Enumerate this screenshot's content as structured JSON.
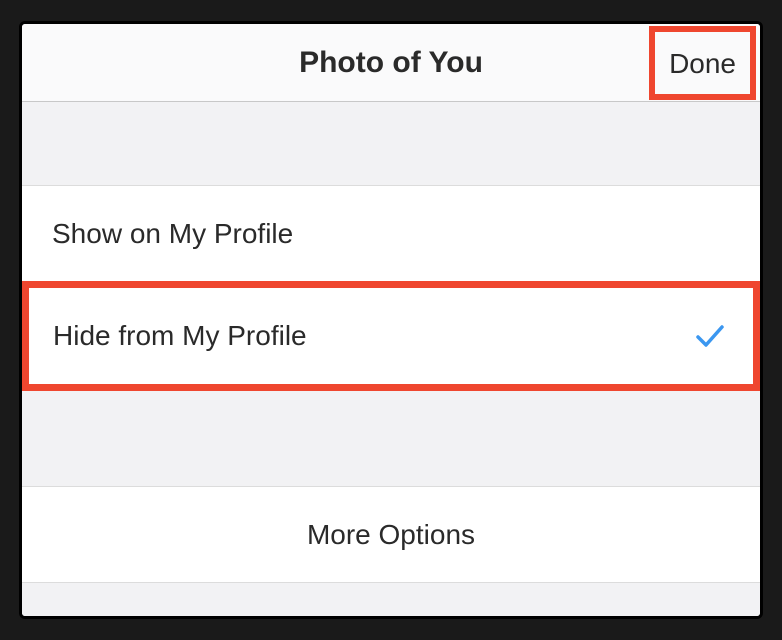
{
  "header": {
    "title": "Photo of You",
    "done_label": "Done"
  },
  "options": {
    "show": "Show on My Profile",
    "hide": "Hide from My Profile",
    "selected": "hide"
  },
  "more": {
    "label": "More Options"
  },
  "highlights": {
    "done": true,
    "hide": true
  },
  "colors": {
    "highlight": "#ef462f",
    "check": "#3b97f0"
  }
}
